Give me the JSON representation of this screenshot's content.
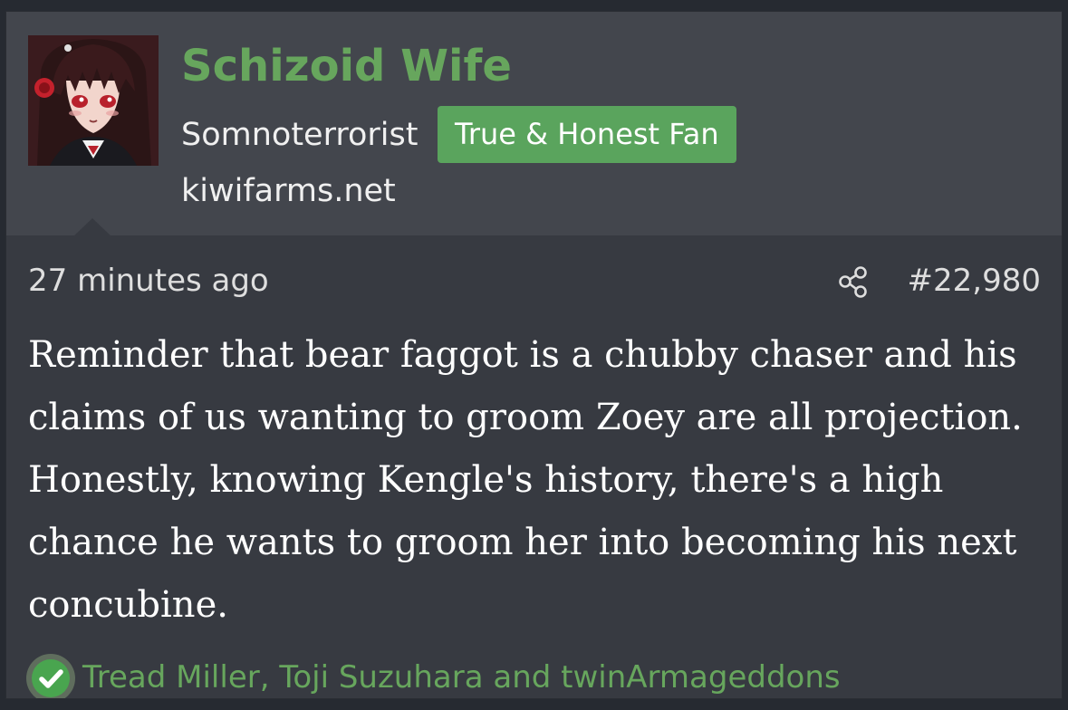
{
  "user": {
    "name": "Schizoid Wife",
    "title": "Somnoterrorist",
    "badge": "True & Honest Fan",
    "site": "kiwifarms.net"
  },
  "post": {
    "time": "27 minutes ago",
    "number": "#22,980",
    "body": "Reminder that bear faggot is a chubby chaser and his claims of us wanting to groom Zoey are all projection. Honestly, knowing Kengle's history, there's a high chance he wants to groom her into becoming his next concubine."
  },
  "reactions": {
    "names": "Tread Miller, Toji Suzuhara and twinArmageddons"
  },
  "colors": {
    "accent": "#67a65d",
    "badge_bg": "#5aa45d",
    "card_bg": "#373a41",
    "header_bg": "#43464d"
  },
  "icons": {
    "share": "share-icon",
    "reaction": "check-circle-icon",
    "avatar": "anime-girl-avatar"
  }
}
